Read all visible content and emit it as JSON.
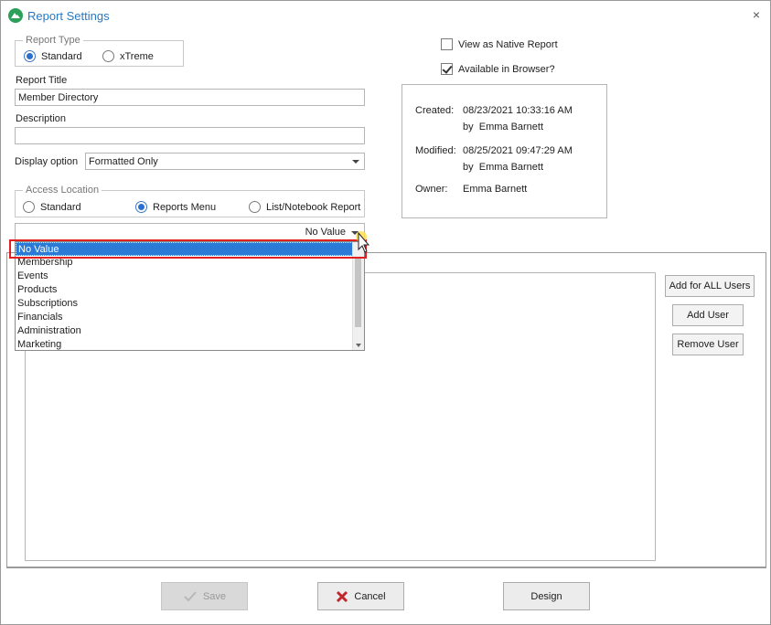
{
  "window": {
    "title": "Report Settings",
    "close_label": "×"
  },
  "report_type": {
    "legend": "Report Type",
    "options": [
      {
        "label": "Standard",
        "selected": true
      },
      {
        "label": "xTreme",
        "selected": false
      }
    ]
  },
  "report_title": {
    "label": "Report Title",
    "value": "Member Directory"
  },
  "description": {
    "label": "Description",
    "value": ""
  },
  "display_option": {
    "label": "Display option",
    "value": "Formatted Only"
  },
  "access_location": {
    "legend": "Access Location",
    "options": [
      {
        "label": "Standard",
        "selected": false
      },
      {
        "label": "Reports Menu",
        "selected": true
      },
      {
        "label": "List/Notebook Report",
        "selected": false
      }
    ]
  },
  "category_combo": {
    "value": "No Value",
    "items": [
      "No Value",
      "Membership",
      "Events",
      "Products",
      "Subscriptions",
      "Financials",
      "Administration",
      "Marketing"
    ],
    "selected_index": 0
  },
  "options": {
    "view_native": {
      "label": "View as Native Report",
      "checked": false
    },
    "available_browser": {
      "label": "Available in Browser?",
      "checked": true
    }
  },
  "info": {
    "created_label": "Created:",
    "created_value": "08/23/2021 10:33:16 AM",
    "created_by": "by  Emma Barnett",
    "modified_label": "Modified:",
    "modified_value": "08/25/2021 09:47:29 AM",
    "modified_by": "by  Emma Barnett",
    "owner_label": "Owner:",
    "owner_value": "Emma Barnett"
  },
  "side_buttons": {
    "add_all": "Add for ALL Users",
    "add_user": "Add User",
    "remove_user": "Remove User"
  },
  "footer": {
    "save": "Save",
    "cancel": "Cancel",
    "design": "Design"
  },
  "colors": {
    "accent": "#2a78c0",
    "selection": "#2a7ad6",
    "highlight_border": "#e02020",
    "cancel_icon": "#c0262d"
  }
}
